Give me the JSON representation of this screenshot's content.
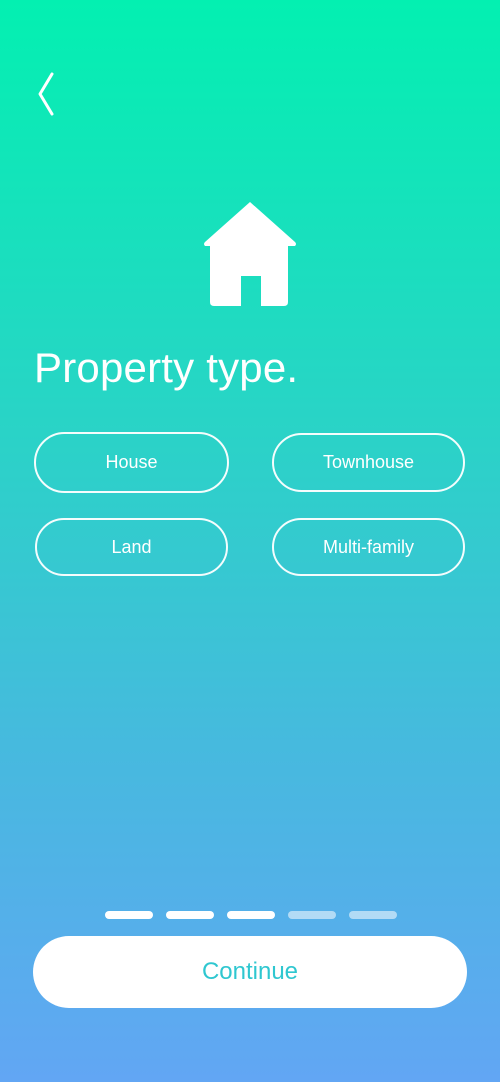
{
  "header": {
    "back_icon": "chevron-left-icon"
  },
  "hero": {
    "icon": "house-icon"
  },
  "title": "Property type.",
  "options": [
    {
      "label": "House"
    },
    {
      "label": "Townhouse"
    },
    {
      "label": "Land"
    },
    {
      "label": "Multi-family"
    }
  ],
  "progress": {
    "total_steps": 5,
    "current_step": 3
  },
  "continue_label": "Continue",
  "colors": {
    "gradient_top": "#03f0b1",
    "gradient_bottom": "#62a6f4",
    "button_text": "#2fc7d0"
  }
}
